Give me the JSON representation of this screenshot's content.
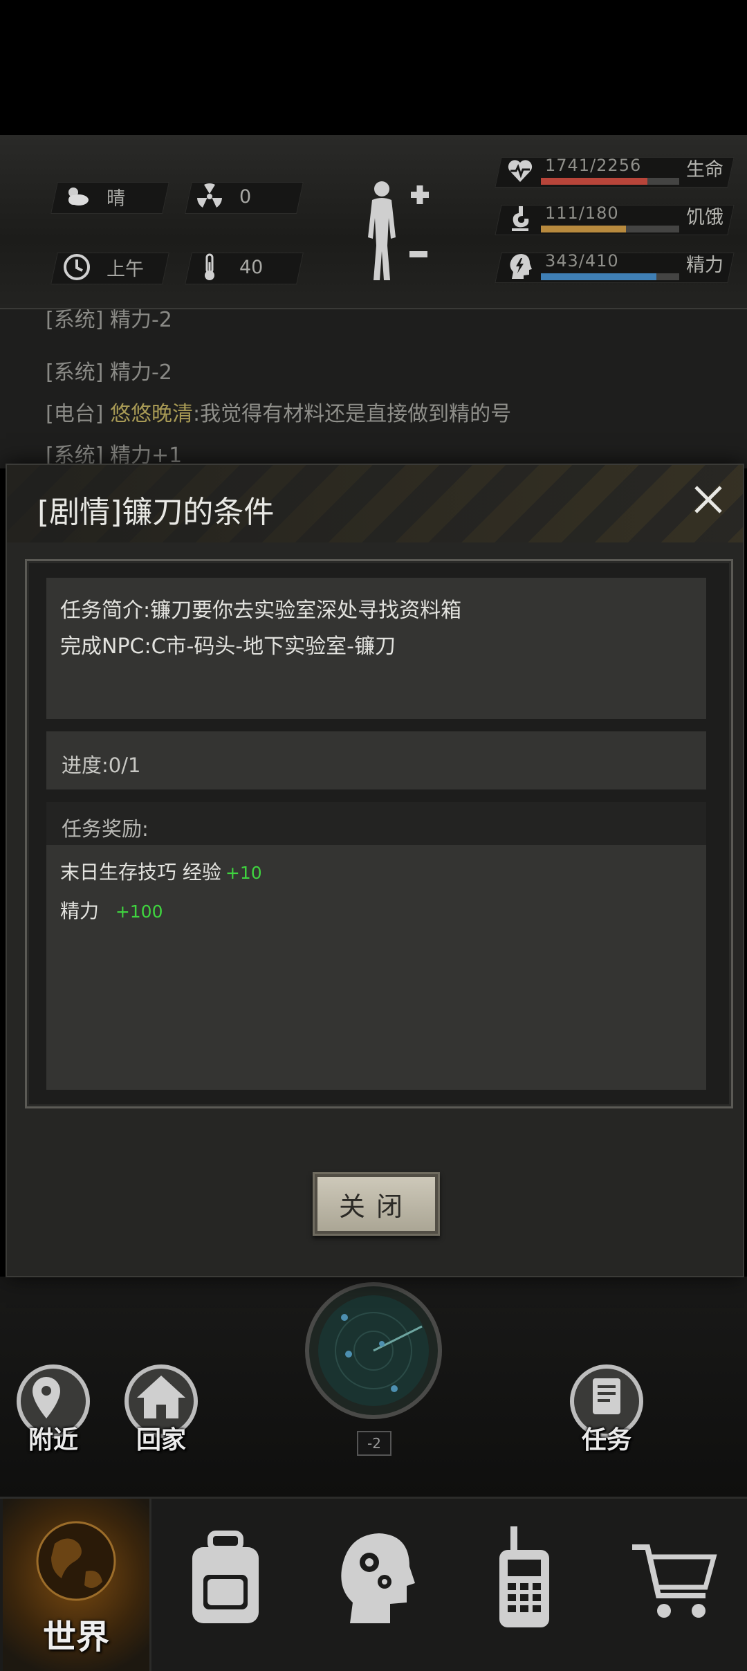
{
  "status": {
    "weather": "晴",
    "radiation": "0",
    "time_of_day": "上午",
    "temperature": "40",
    "health": {
      "value": "1741/2256",
      "label": "生命",
      "fraction": 0.772,
      "color": "#b8453a"
    },
    "hunger": {
      "value": "111/180",
      "label": "饥饿",
      "fraction": 0.617,
      "color": "#b88a3e"
    },
    "energy": {
      "value": "343/410",
      "label": "精力",
      "fraction": 0.837,
      "color": "#3f7fb5"
    }
  },
  "log": {
    "lines": [
      {
        "tag": "[系统]",
        "text": "精力-2"
      },
      {
        "tag": "[系统]",
        "text": "精力-2"
      },
      {
        "tag": "[电台]",
        "name": "悠悠晚清",
        "text": ":我觉得有材料还是直接做到精的号"
      },
      {
        "tag": "[系统]",
        "text": "精力+1"
      }
    ]
  },
  "dialog": {
    "title": "[剧情]镰刀的条件",
    "desc_line1": "任务简介:镰刀要你去实验室深处寻找资料箱",
    "desc_line2": "完成NPC:C市-码头-地下实验室-镰刀",
    "progress": "进度:0/1",
    "reward_title": "任务奖励:",
    "reward1_name": "末日生存技巧 经验",
    "reward1_value": "+10",
    "reward2_name": "精力",
    "reward2_value": "+100",
    "close_label": "关闭"
  },
  "world": {
    "nearby": "附近",
    "home": "回家",
    "tasks": "任务",
    "radar_level": "-2"
  },
  "nav": {
    "world": "世界"
  }
}
